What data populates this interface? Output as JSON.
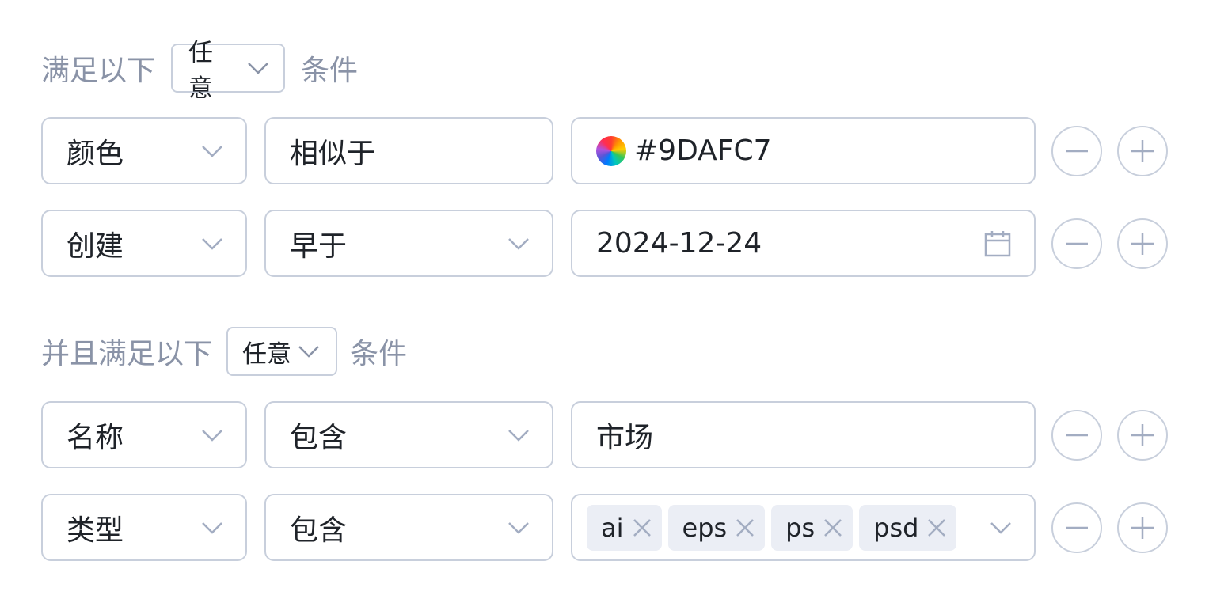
{
  "group1": {
    "prefix": "满足以下",
    "mode": "任意",
    "suffix": "条件",
    "rows": [
      {
        "field": "颜色",
        "operator": "相似于",
        "value": "#9DAFC7"
      },
      {
        "field": "创建",
        "operator": "早于",
        "value": "2024-12-24"
      }
    ]
  },
  "group2": {
    "prefix": "并且满足以下",
    "mode": "任意",
    "suffix": "条件",
    "rows": [
      {
        "field": "名称",
        "operator": "包含",
        "value": "市场"
      },
      {
        "field": "类型",
        "operator": "包含",
        "tags": [
          "ai",
          "eps",
          "ps",
          "psd"
        ]
      }
    ]
  },
  "icons": {
    "dropdown": "chevron-down-icon",
    "remove": "minus-icon",
    "add": "plus-icon",
    "calendar": "calendar-icon",
    "tag_remove": "close-icon",
    "color": "color-wheel-icon"
  },
  "colors": {
    "border": "#c8cfdc",
    "label": "#8a93a7",
    "text": "#1f2329",
    "tag_bg": "#ebeef5",
    "icon": "#a3adc2"
  }
}
